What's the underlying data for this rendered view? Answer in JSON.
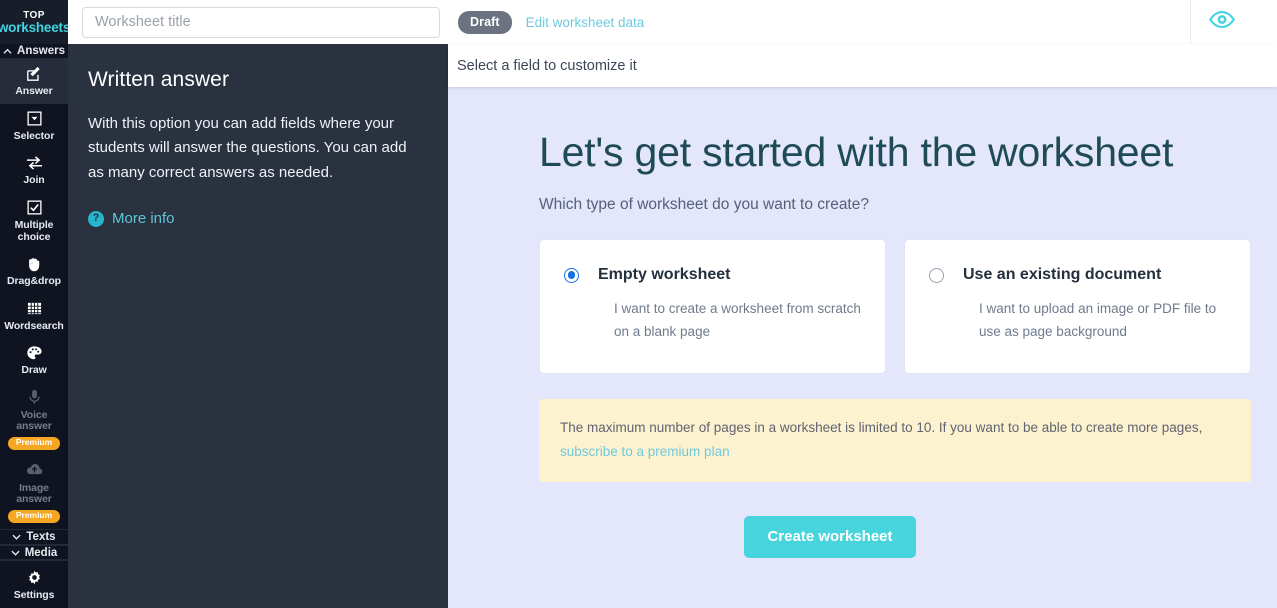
{
  "brand": {
    "top": "TOP",
    "name": "worksheets",
    "accent": "#43d3e0"
  },
  "topbar": {
    "title_value": "",
    "title_placeholder": "Worksheet title",
    "status_badge": "Draft",
    "edit_data_link": "Edit worksheet data",
    "preview_icon": "eye-icon"
  },
  "sidebar": {
    "sections": [
      {
        "label": "Answers",
        "icon": "chevron-up-icon",
        "expanded": true
      },
      {
        "label": "Texts",
        "icon": "chevron-down-icon",
        "expanded": false
      },
      {
        "label": "Media",
        "icon": "chevron-down-icon",
        "expanded": false
      }
    ],
    "items": [
      {
        "label": "Answer",
        "icon": "pencil-square-icon",
        "active": true,
        "disabled": false,
        "badge": ""
      },
      {
        "label": "Selector",
        "icon": "dropdown-box-icon",
        "active": false,
        "disabled": false,
        "badge": ""
      },
      {
        "label": "Join",
        "icon": "arrows-exchange-icon",
        "active": false,
        "disabled": false,
        "badge": ""
      },
      {
        "label": "Multiple choice",
        "icon": "checkbox-checked-icon",
        "active": false,
        "disabled": false,
        "badge": ""
      },
      {
        "label": "Drag&drop",
        "icon": "hand-grab-icon",
        "active": false,
        "disabled": false,
        "badge": ""
      },
      {
        "label": "Wordsearch",
        "icon": "grid-table-icon",
        "active": false,
        "disabled": false,
        "badge": ""
      },
      {
        "label": "Draw",
        "icon": "palette-icon",
        "active": false,
        "disabled": false,
        "badge": ""
      },
      {
        "label": "Voice answer",
        "icon": "microphone-icon",
        "active": false,
        "disabled": true,
        "badge": "Premium"
      },
      {
        "label": "Image answer",
        "icon": "cloud-upload-icon",
        "active": false,
        "disabled": true,
        "badge": "Premium"
      }
    ],
    "settings": {
      "label": "Settings",
      "icon": "gear-icon"
    }
  },
  "info_panel": {
    "title": "Written answer",
    "body": "With this option you can add fields where your students will answer the questions. You can add as many correct answers as needed.",
    "more_info": "More info",
    "more_info_icon": "question-circle-icon"
  },
  "main": {
    "subbar_text": "Select a field to customize it",
    "heading": "Let's get started with the worksheet",
    "subheading": "Which type of worksheet do you want to create?",
    "options": [
      {
        "title": "Empty worksheet",
        "description": "I want to create a worksheet from scratch on a blank page",
        "selected": true
      },
      {
        "title": "Use an existing document",
        "description": "I want to upload an image or PDF file to use as page background",
        "selected": false
      }
    ],
    "notice_text": "The maximum number of pages in a worksheet is limited to 10. If you want to be able to create more pages,",
    "notice_link": "subscribe to a premium plan",
    "create_button": "Create worksheet"
  }
}
